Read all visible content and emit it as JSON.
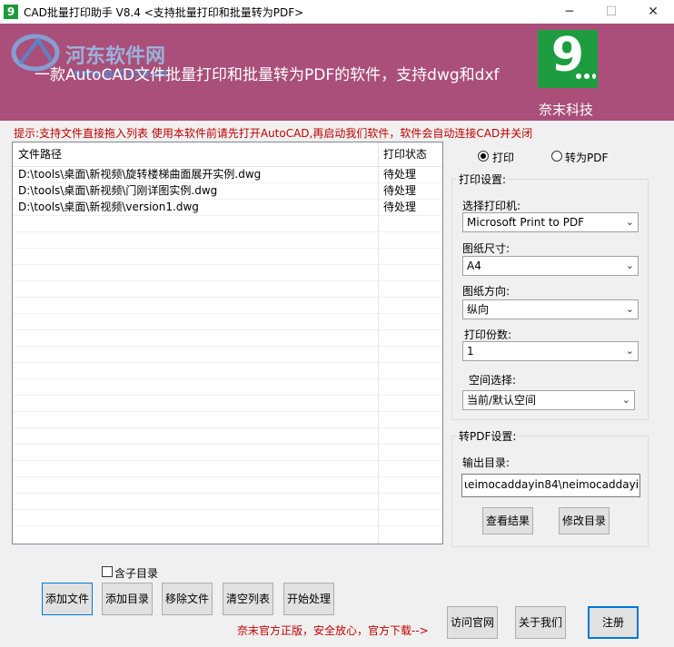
{
  "window": {
    "icon_text": "9",
    "title": "CAD批量打印助手 V8.4      <支持批量打印和批量转为PDF>",
    "minimize": "─",
    "maximize": "☐",
    "close": "✕"
  },
  "banner": {
    "watermark_text": "河东软件网",
    "watermark_url": "www.pc0359.cn",
    "slogan": "一款AutoCAD文件批量打印和批量转为PDF的软件，支持dwg和dxf",
    "logo_text": "9",
    "brand": "奈末科技",
    "background_color": "#a94f79"
  },
  "hint": "提示:支持文件直接拖入列表 使用本软件前请先打开AutoCAD,再启动我们软件，软件会自动连接CAD并关闭",
  "file_table": {
    "columns": [
      "文件路径",
      "打印状态"
    ],
    "rows": [
      {
        "path": "D:\\tools\\桌面\\新视频\\旋转楼梯曲面展开实例.dwg",
        "status": "待处理"
      },
      {
        "path": "D:\\tools\\桌面\\新视频\\门刚详图实例.dwg",
        "status": "待处理"
      },
      {
        "path": "D:\\tools\\桌面\\新视频\\version1.dwg",
        "status": "待处理"
      }
    ]
  },
  "mode": {
    "print_label": "打印",
    "pdf_label": "转为PDF",
    "selected": "打印"
  },
  "print_settings": {
    "group_label": "打印设置:",
    "printer_label": "选择打印机:",
    "printer_value": "Microsoft Print to PDF",
    "paper_size_label": "图纸尺寸:",
    "paper_size_value": "A4",
    "orientation_label": "图纸方向:",
    "orientation_value": "纵向",
    "copies_label": "打印份数:",
    "copies_value": "1",
    "space_label": "空间选择:",
    "space_value": "当前/默认空间"
  },
  "pdf_settings": {
    "group_label": "转PDF设置:",
    "output_label": "输出目录:",
    "output_value": "ιeimocaddayin84\\neimocaddayin84",
    "view_result": "查看结果",
    "change_dir": "修改目录"
  },
  "bottom": {
    "include_subdir": "含子目录",
    "add_file": "添加文件",
    "add_dir": "添加目录",
    "remove_file": "移除文件",
    "clear_list": "清空列表",
    "start": "开始处理",
    "promo": "奈末官方正版，安全放心，官方下载-->",
    "website": "访问官网",
    "about": "关于我们",
    "register": "注册"
  }
}
